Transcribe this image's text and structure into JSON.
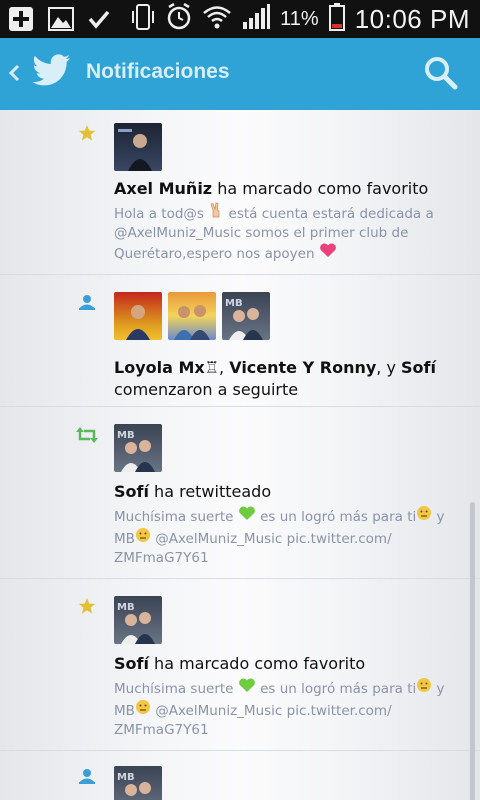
{
  "status_bar": {
    "battery_percent": "11%",
    "time": "10:06 PM"
  },
  "app_bar": {
    "title": "Notificaciones"
  },
  "notifications": [
    {
      "type": "favorite",
      "actor": "Axel Muñiz",
      "action": " ha marcado como favorito",
      "tweet_before": "Hola a tod@s ",
      "tweet_mid": " está cuenta estará dedicada a @AxelMuniz_Music somos el primer club de Querétaro,espero nos apoyen "
    },
    {
      "type": "follow",
      "actor_1": "Loyola Mx♖",
      "sep_1": ", ",
      "actor_2": "Vicente Y Ronny",
      "sep_2": ", y ",
      "actor_3": "Sofí",
      "action": "comenzaron a seguirte"
    },
    {
      "type": "retweet",
      "actor": "Sofí",
      "action": " ha retwitteado",
      "tweet_before": "Muchísima suerte ",
      "tweet_mid": " es un logró más para ti",
      "tweet_after_1": " y MB",
      "tweet_after_2": " @AxelMuniz_Music pic.twitter.com/ ZMFmaG7Y61"
    },
    {
      "type": "favorite",
      "actor": "Sofí",
      "action": " ha marcado como favorito",
      "tweet_before": "Muchísima suerte ",
      "tweet_mid": " es un logró más para ti",
      "tweet_after_1": " y MB",
      "tweet_after_2": " @AxelMuniz_Music pic.twitter.com/ ZMFmaG7Y61"
    },
    {
      "type": "follow"
    }
  ],
  "colors": {
    "app_bar": "#2fa2d6",
    "favorite_star": "#e2c234",
    "follow_icon": "#3a9fd6",
    "retweet_icon": "#5cb85c",
    "snippet_text": "#8a93a8"
  },
  "icons": {
    "back": "chevron-left-icon",
    "logo": "twitter-bird-icon",
    "search": "search-icon",
    "favorite": "star-icon",
    "follow": "person-icon",
    "retweet": "retweet-icon"
  }
}
